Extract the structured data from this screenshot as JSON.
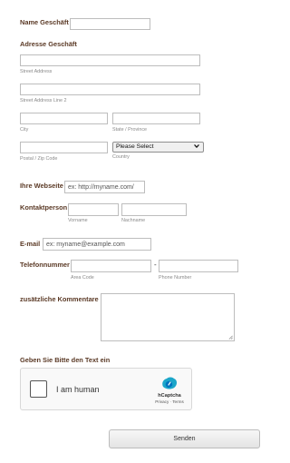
{
  "business": {
    "name_label": "Name Geschäft"
  },
  "address": {
    "heading": "Adresse Geschäft",
    "street1_label": "Street Address",
    "street2_label": "Street Address Line 2",
    "city_label": "City",
    "state_label": "State / Province",
    "zip_label": "Postal / Zip Code",
    "country_label": "Country",
    "country_selected": "Please Select"
  },
  "website": {
    "label": "Ihre Webseite",
    "placeholder": "ex: http://myname.com/"
  },
  "contact": {
    "label": "Kontaktperson",
    "first_label": "Vorname",
    "last_label": "Nachname"
  },
  "email": {
    "label": "E-mail",
    "placeholder": "ex: myname@example.com"
  },
  "phone": {
    "label": "Telefonnummer",
    "area_label": "Area Code",
    "separator": "-",
    "number_label": "Phone Number"
  },
  "comments": {
    "label": "zusätzliche Kommentare"
  },
  "captcha": {
    "heading": "Geben Sie Bitte den Text ein",
    "checkbox_text": "I am human",
    "brand": "hCaptcha",
    "links": "Privacy · Terms"
  },
  "submit": {
    "label": "Senden"
  },
  "colors": {
    "label_text": "#5b3a26",
    "hcaptcha_blue": "#00838f"
  },
  "icons": {
    "select_arrow": "chevron-down-icon",
    "captcha_logo": "hcaptcha-logo-icon",
    "resize": "resize-grip-icon"
  }
}
